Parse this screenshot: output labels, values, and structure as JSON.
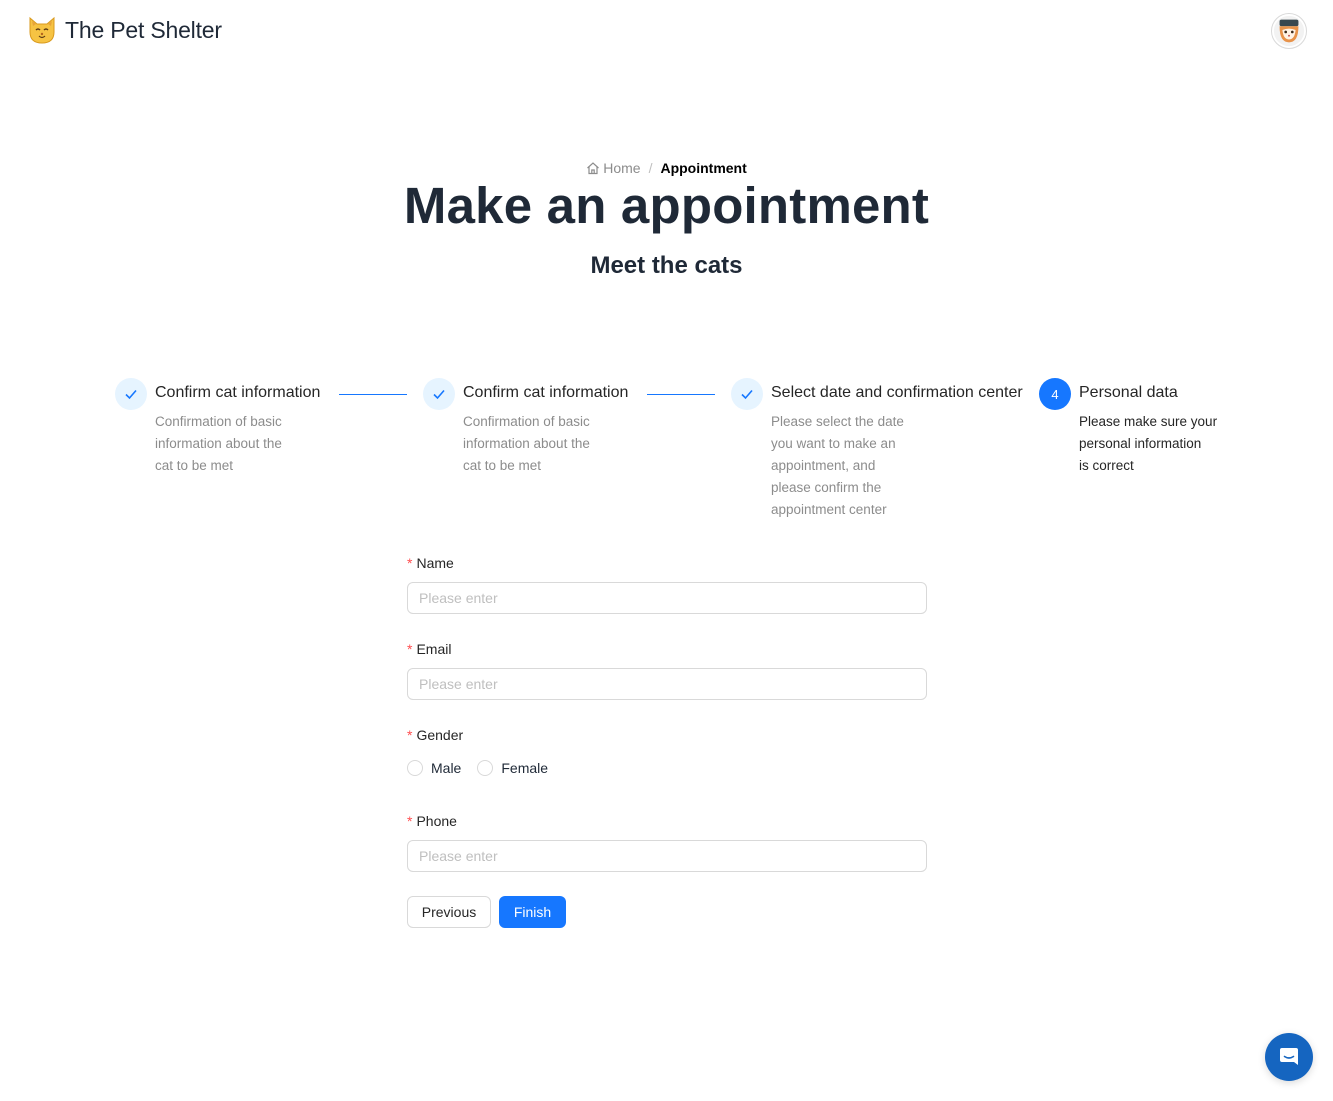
{
  "header": {
    "brand": "The Pet Shelter",
    "logo_icon": "cat-face-icon",
    "avatar_icon": "user-avatar"
  },
  "breadcrumb": {
    "home": "Home",
    "separator": "/",
    "current": "Appointment"
  },
  "page": {
    "title": "Make an appointment",
    "subtitle": "Meet the cats"
  },
  "steps": [
    {
      "status": "done",
      "title": "Confirm cat information",
      "desc_lines": [
        "Confirmation of basic",
        "information about the",
        "cat to be met"
      ]
    },
    {
      "status": "done",
      "title": "Confirm cat information",
      "desc_lines": [
        "Confirmation of basic",
        "information about the",
        "cat to be met"
      ]
    },
    {
      "status": "done",
      "title": "Select date and confirmation center",
      "desc_lines": [
        "Please select the date",
        "you want to make an",
        "appointment, and",
        "please confirm the",
        "appointment center"
      ]
    },
    {
      "status": "active",
      "number": "4",
      "title": "Personal data",
      "desc_lines": [
        "Please make sure your",
        "personal information",
        "is correct"
      ]
    }
  ],
  "form": {
    "required_mark": "*",
    "name": {
      "label": "Name",
      "placeholder": "Please enter",
      "value": ""
    },
    "email": {
      "label": "Email",
      "placeholder": "Please enter",
      "value": ""
    },
    "gender": {
      "label": "Gender",
      "options": [
        "Male",
        "Female"
      ],
      "selected": null
    },
    "phone": {
      "label": "Phone",
      "placeholder": "Please enter",
      "value": ""
    }
  },
  "actions": {
    "previous": "Previous",
    "finish": "Finish"
  },
  "colors": {
    "primary": "#1677ff",
    "text": "#1f2937",
    "muted": "#8c8c8c",
    "required": "#ff4d4f",
    "chat": "#1565c0"
  },
  "chat_button": {
    "icon": "chat-bubble-icon"
  }
}
